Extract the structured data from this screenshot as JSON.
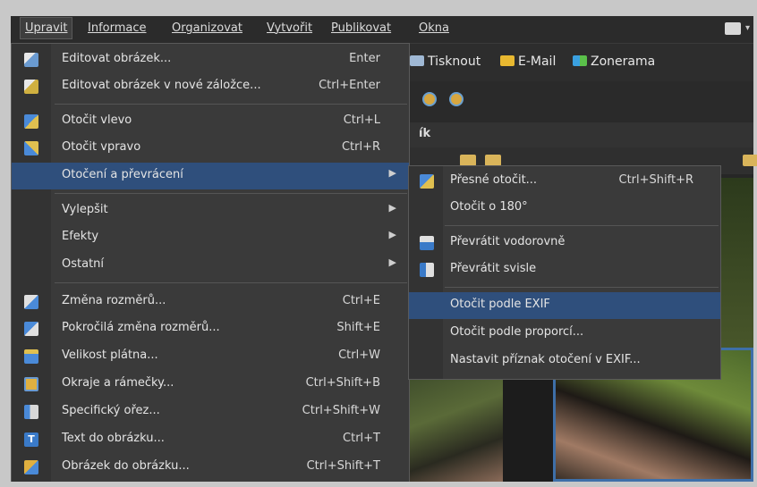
{
  "menubar": {
    "items": [
      "Upravit",
      "Informace",
      "Organizovat",
      "Vytvořit",
      "Publikovat",
      "Okna"
    ]
  },
  "toolbar": {
    "print": "Tisknout",
    "email": "E-Mail",
    "zonerama": "Zonerama"
  },
  "panel": {
    "title_fragment": "ík"
  },
  "menu": {
    "items": [
      {
        "label": "Editovat obrázek...",
        "key": "Enter",
        "icon": "edit-image-icon"
      },
      {
        "label": "Editovat obrázek v nové záložce...",
        "key": "Ctrl+Enter",
        "icon": "edit-new-tab-icon"
      },
      {
        "label": "Otočit vlevo",
        "key": "Ctrl+L",
        "icon": "rotate-left-icon"
      },
      {
        "label": "Otočit vpravo",
        "key": "Ctrl+R",
        "icon": "rotate-right-icon"
      },
      {
        "label": "Otočení a převrácení",
        "key": "",
        "submenu": true
      },
      {
        "label": "Vylepšit",
        "key": "",
        "submenu": true
      },
      {
        "label": "Efekty",
        "key": "",
        "submenu": true
      },
      {
        "label": "Ostatní",
        "key": "",
        "submenu": true
      },
      {
        "label": "Změna rozměrů...",
        "key": "Ctrl+E",
        "icon": "resize-icon"
      },
      {
        "label": "Pokročilá změna rozměrů...",
        "key": "Shift+E",
        "icon": "advanced-resize-icon"
      },
      {
        "label": "Velikost plátna...",
        "key": "Ctrl+W",
        "icon": "canvas-size-icon"
      },
      {
        "label": "Okraje a rámečky...",
        "key": "Ctrl+Shift+B",
        "icon": "borders-icon"
      },
      {
        "label": "Specifický ořez...",
        "key": "Ctrl+Shift+W",
        "icon": "crop-icon"
      },
      {
        "label": "Text do obrázku...",
        "key": "Ctrl+T",
        "icon": "text-icon"
      },
      {
        "label": "Obrázek do obrázku...",
        "key": "Ctrl+Shift+T",
        "icon": "picture-in-picture-icon"
      }
    ]
  },
  "submenu": {
    "items": [
      {
        "label": "Přesné otočit...",
        "key": "Ctrl+Shift+R",
        "icon": "precise-rotate-icon"
      },
      {
        "label": "Otočit o 180°",
        "key": ""
      },
      {
        "label": "Převrátit vodorovně",
        "key": "",
        "icon": "flip-horizontal-icon"
      },
      {
        "label": "Převrátit svisle",
        "key": "",
        "icon": "flip-vertical-icon"
      },
      {
        "label": "Otočit podle EXIF",
        "key": ""
      },
      {
        "label": "Otočit podle proporcí...",
        "key": ""
      },
      {
        "label": "Nastavit příznak otočení v EXIF...",
        "key": ""
      }
    ]
  },
  "colors": {
    "highlight": "#2f4f7c",
    "menu_bg": "#3a3a3a"
  }
}
